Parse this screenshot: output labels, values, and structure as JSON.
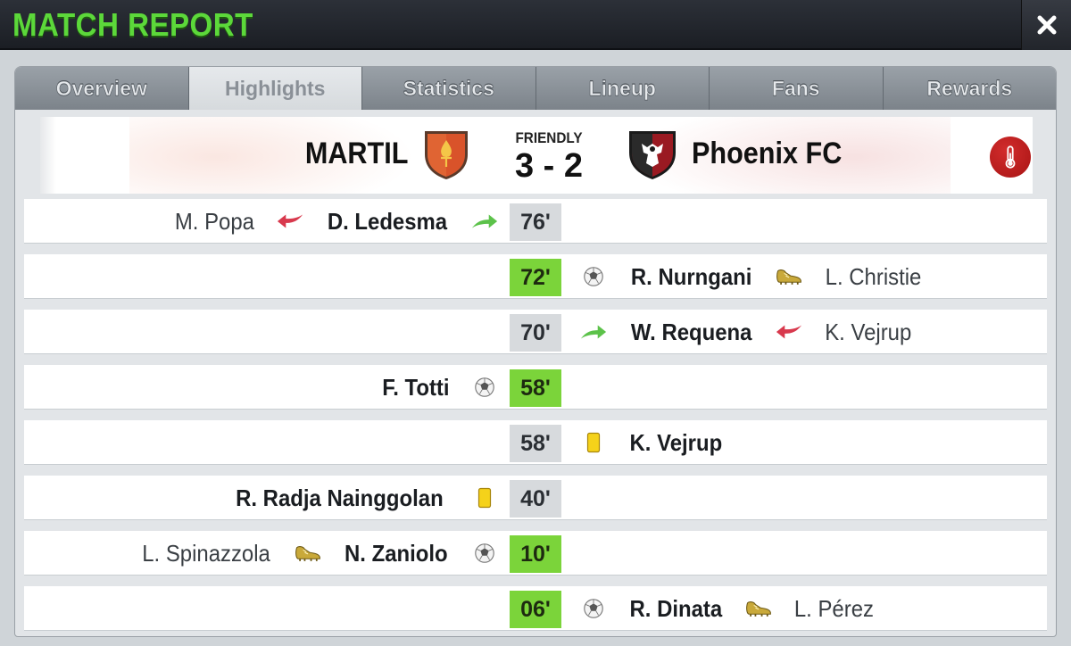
{
  "header": {
    "title": "MATCH REPORT",
    "close_icon": "close-icon"
  },
  "tabs": [
    {
      "label": "Overview",
      "active": false
    },
    {
      "label": "Highlights",
      "active": true
    },
    {
      "label": "Statistics",
      "active": false
    },
    {
      "label": "Lineup",
      "active": false
    },
    {
      "label": "Fans",
      "active": false
    },
    {
      "label": "Rewards",
      "active": false
    }
  ],
  "match": {
    "home_team": "MARTIL",
    "away_team": "Phoenix FC",
    "competition": "FRIENDLY",
    "score": "3 - 2",
    "home_color": "#d9532a",
    "away_color": "#b01e2a",
    "temperature_icon": "thermometer-icon"
  },
  "events": [
    {
      "minute": "76'",
      "goal": false,
      "side": "home",
      "primary": "D. Ledesma",
      "primary_icon": "sub-in-arrow-icon",
      "secondary": "M. Popa",
      "secondary_icon": "sub-out-arrow-icon"
    },
    {
      "minute": "72'",
      "goal": true,
      "side": "away",
      "primary": "R. Nurngani",
      "primary_icon": "ball-icon",
      "secondary": "L. Christie",
      "secondary_icon": "boot-icon"
    },
    {
      "minute": "70'",
      "goal": false,
      "side": "away",
      "primary": "W. Requena",
      "primary_icon": "sub-in-arrow-icon",
      "secondary": "K. Vejrup",
      "secondary_icon": "sub-out-arrow-icon"
    },
    {
      "minute": "58'",
      "goal": true,
      "side": "home",
      "primary": "F. Totti",
      "primary_icon": "ball-icon",
      "secondary": "",
      "secondary_icon": ""
    },
    {
      "minute": "58'",
      "goal": false,
      "side": "away",
      "primary": "K. Vejrup",
      "primary_icon": "yellow-card-icon",
      "secondary": "",
      "secondary_icon": ""
    },
    {
      "minute": "40'",
      "goal": false,
      "side": "home",
      "primary": "R. Radja Nainggolan",
      "primary_icon": "yellow-card-icon",
      "secondary": "",
      "secondary_icon": ""
    },
    {
      "minute": "10'",
      "goal": true,
      "side": "home",
      "primary": "N. Zaniolo",
      "primary_icon": "ball-icon",
      "secondary": "L. Spinazzola",
      "secondary_icon": "boot-icon"
    },
    {
      "minute": "06'",
      "goal": true,
      "side": "away",
      "primary": "R. Dinata",
      "primary_icon": "ball-icon",
      "secondary": "L. Pérez",
      "secondary_icon": "boot-icon"
    }
  ],
  "colors": {
    "title_green": "#5cd83a",
    "goal_green": "#7bd43a",
    "minute_grey": "#d7dadd",
    "card_yellow": "#f5d21a",
    "sub_in_green": "#5cc24a",
    "sub_out_red": "#d8394d"
  }
}
